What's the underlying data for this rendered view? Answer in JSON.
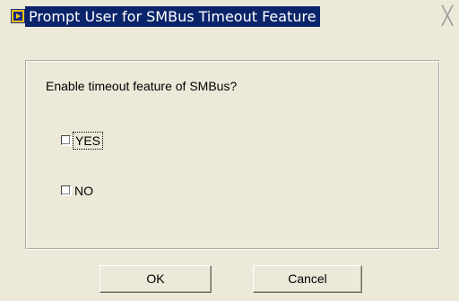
{
  "window": {
    "title": "Prompt User for SMBus Timeout Feature",
    "close_symbol": "╳",
    "icon": "labview-icon",
    "title_bg_color": "#0a246a",
    "background_color": "#ece9d8"
  },
  "dialog": {
    "question": "Enable timeout feature of SMBus?",
    "options": [
      {
        "label": "YES",
        "checked": false,
        "focused": true
      },
      {
        "label": "NO",
        "checked": false,
        "focused": false
      }
    ]
  },
  "buttons": {
    "ok_label": "OK",
    "cancel_label": "Cancel"
  }
}
